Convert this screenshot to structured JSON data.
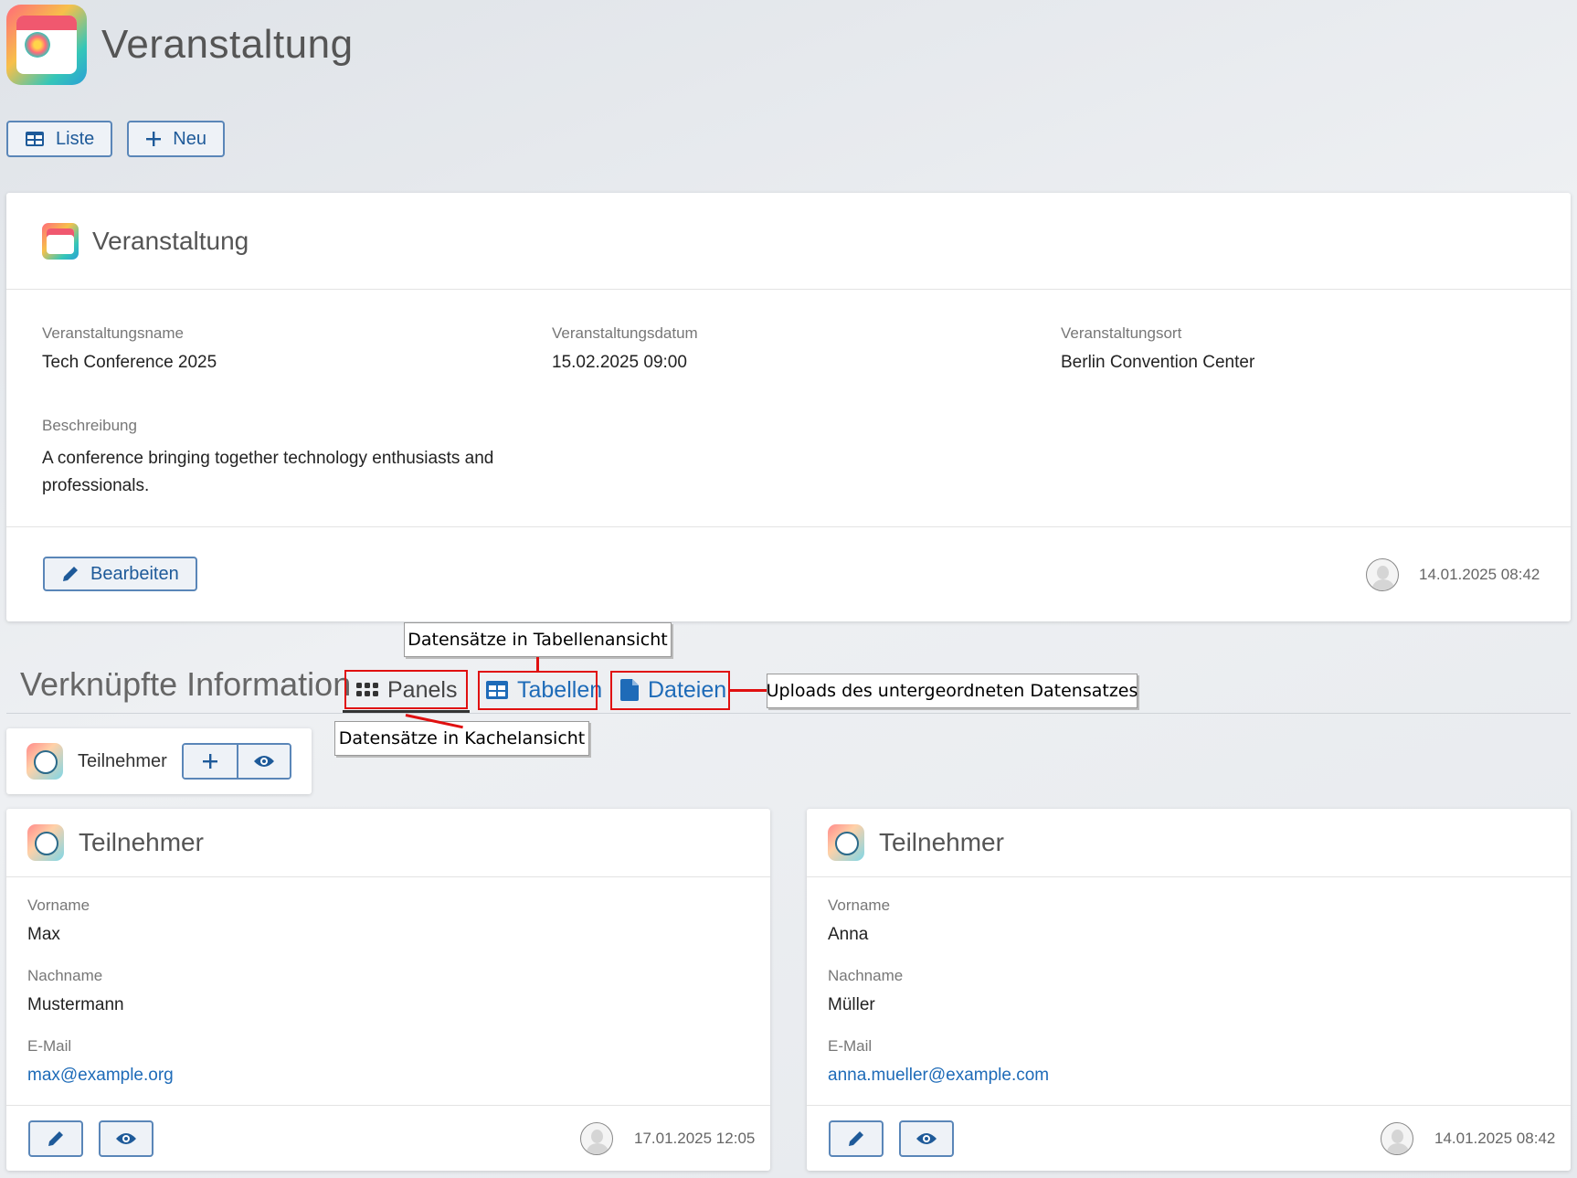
{
  "app": {
    "title": "Veranstaltung"
  },
  "toolbar": {
    "list_label": "Liste",
    "new_label": "Neu"
  },
  "record": {
    "title": "Veranstaltung",
    "fields": {
      "name_label": "Veranstaltungsname",
      "name_value": "Tech Conference 2025",
      "date_label": "Veranstaltungsdatum",
      "date_value": "15.02.2025 09:00",
      "place_label": "Veranstaltungsort",
      "place_value": "Berlin Convention Center",
      "desc_label": "Beschreibung",
      "desc_value": "A conference bringing together technology enthusiasts and professionals."
    },
    "edit_label": "Bearbeiten",
    "timestamp": "14.01.2025 08:42"
  },
  "related": {
    "title": "Verknüpfte Information",
    "tabs": [
      {
        "label": "Panels",
        "icon": "grid-icon"
      },
      {
        "label": "Tabellen",
        "icon": "table-icon"
      },
      {
        "label": "Dateien",
        "icon": "file-icon"
      }
    ],
    "child_label": "Teilnehmer"
  },
  "annotations": {
    "tables": "Datensätze in Tabellenansicht",
    "panels": "Datensätze in Kachelansicht",
    "files": "Uploads des untergeordneten Datensatzes"
  },
  "participants": [
    {
      "title": "Teilnehmer",
      "first_label": "Vorname",
      "first_value": "Max",
      "last_label": "Nachname",
      "last_value": "Mustermann",
      "email_label": "E-Mail",
      "email_value": "max@example.org",
      "timestamp": "17.01.2025 12:05"
    },
    {
      "title": "Teilnehmer",
      "first_label": "Vorname",
      "first_value": "Anna",
      "last_label": "Nachname",
      "last_value": "Müller",
      "email_label": "E-Mail",
      "email_value": "anna.mueller@example.com",
      "timestamp": "14.01.2025 08:42"
    }
  ],
  "colors": {
    "accent": "#1e6bb8",
    "annotation": "#e01010",
    "button_border": "#5a86b8"
  }
}
